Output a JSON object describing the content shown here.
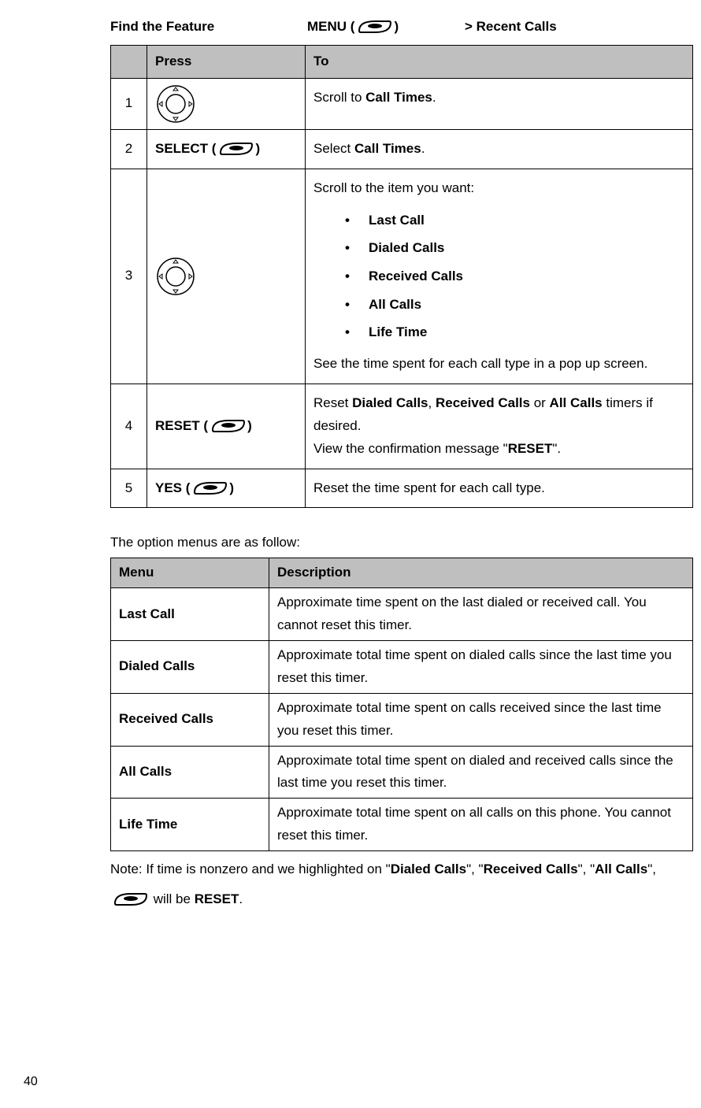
{
  "header": {
    "find_feature": "Find the Feature",
    "menu_label": "MENU (",
    "menu_label_close": ")",
    "recent_calls": "> Recent Calls"
  },
  "steps_table": {
    "col_press": "Press",
    "col_to": "To",
    "rows": {
      "r1": {
        "num": "1",
        "to_pre": "Scroll to ",
        "to_bold": "Call Times",
        "to_post": "."
      },
      "r2": {
        "num": "2",
        "press_pre": "SELECT (",
        "press_post": ")",
        "to_pre": "Select ",
        "to_bold": "Call Times",
        "to_post": "."
      },
      "r3": {
        "num": "3",
        "to_intro": "Scroll to the item you want:",
        "b1": "Last Call",
        "b2": "Dialed Calls",
        "b3": "Received Calls",
        "b4": "All Calls",
        "b5": "Life Time",
        "to_outro": "See the time spent for each call type in a pop up screen."
      },
      "r4": {
        "num": "4",
        "press_pre": "RESET (",
        "press_post": ")",
        "to_l1_pre": "Reset ",
        "to_l1_b1": "Dialed Calls",
        "to_l1_m1": ", ",
        "to_l1_b2": "Received Calls",
        "to_l1_m2": " or ",
        "to_l1_b3": "All Calls",
        "to_l1_post": " timers if desired.",
        "to_l2_pre": "View the confirmation message \"",
        "to_l2_bold": "RESET",
        "to_l2_post": "\"."
      },
      "r5": {
        "num": "5",
        "press_pre": "YES (",
        "press_post": ")",
        "to": "Reset the time spent for each call type."
      }
    }
  },
  "menus_intro": "The option menus are as follow:",
  "menus_table": {
    "col_menu": "Menu",
    "col_desc": "Description",
    "rows": {
      "r1": {
        "name": "Last Call",
        "desc": "Approximate time spent on the last dialed or received call. You cannot reset this timer."
      },
      "r2": {
        "name": "Dialed Calls",
        "desc": "Approximate total time spent on dialed calls since the last time you reset this timer."
      },
      "r3": {
        "name": "Received Calls",
        "desc": "Approximate total time spent on calls received since the last time you reset this timer."
      },
      "r4": {
        "name": "All Calls",
        "desc": "Approximate total time spent on dialed and received calls since the last time you reset this timer."
      },
      "r5": {
        "name": "Life Time",
        "desc": "Approximate total time spent on all calls on this phone. You cannot reset this timer."
      }
    }
  },
  "note": {
    "p1": "Note: If time is nonzero and we highlighted on \"",
    "b1": "Dialed Calls",
    "p2": "\", \"",
    "b2": "Received Calls",
    "p3": "\", \"",
    "b3": "All Calls",
    "p4": "\", ",
    "p5": " will be ",
    "b4": "RESET",
    "p6": "."
  },
  "page_number": "40"
}
